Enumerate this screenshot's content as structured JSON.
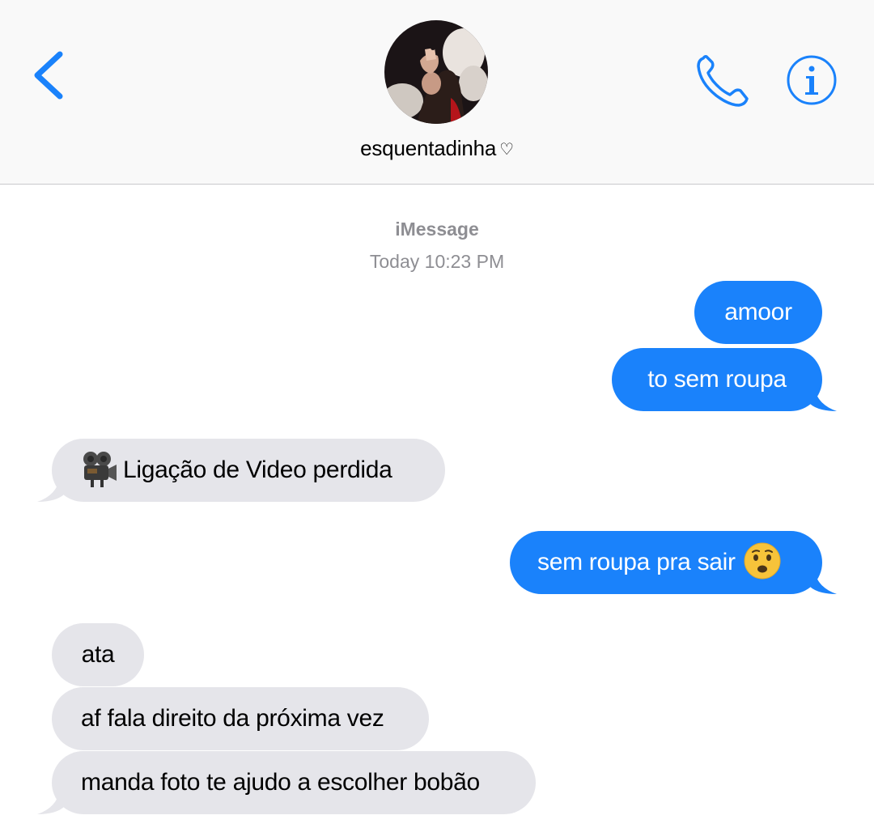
{
  "header": {
    "contact_name": "esquentadinha",
    "heart": "♡"
  },
  "conversation": {
    "service": "iMessage",
    "timestamp_label": "Today",
    "timestamp_time": "10:23 PM"
  },
  "messages": [
    {
      "direction": "outgoing",
      "text": "amoor"
    },
    {
      "direction": "outgoing",
      "text": "to sem roupa"
    },
    {
      "direction": "incoming",
      "text": "Ligação de Video perdida",
      "emoji": "movie-camera"
    },
    {
      "direction": "outgoing",
      "text": "sem roupa pra sair",
      "emoji": "anguished-face"
    },
    {
      "direction": "incoming",
      "text": "ata"
    },
    {
      "direction": "incoming",
      "text": "af fala direito da próxima vez"
    },
    {
      "direction": "incoming",
      "text": "manda foto te ajudo a escolher bobão"
    }
  ],
  "colors": {
    "accent": "#1a82fb",
    "incoming_bubble": "#e5e5ea",
    "meta_text": "#8e8e93",
    "header_bg": "#f9f9f9"
  },
  "icons": {
    "back": "chevron-left-icon",
    "call": "phone-icon",
    "info": "info-icon"
  }
}
